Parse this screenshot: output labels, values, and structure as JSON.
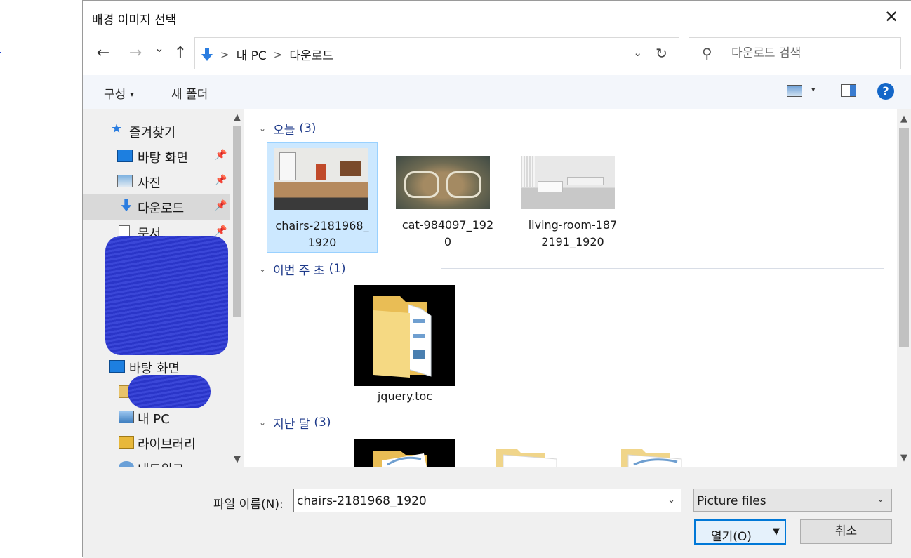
{
  "dialog": {
    "title": "배경 이미지 선택",
    "close_glyph": "✕"
  },
  "nav": {
    "back": "←",
    "forward": "→",
    "recent": "⌄",
    "up": "↑",
    "address": {
      "sep": ">",
      "items": [
        "내 PC",
        "다운로드"
      ],
      "dropdown": "⌄",
      "refresh": "↻"
    },
    "search_placeholder": "다운로드 검색"
  },
  "toolbar": {
    "organize": "구성",
    "caret": "▾",
    "new_folder": "새 폴더",
    "help": "?"
  },
  "sidebar": {
    "quick_access": "즐겨찾기",
    "items": [
      {
        "label": "바탕 화면",
        "pin": "📌"
      },
      {
        "label": "사진",
        "pin": "📌"
      },
      {
        "label": "다운로드",
        "pin": "📌"
      },
      {
        "label": "문서",
        "pin": "📌"
      }
    ],
    "desktop": "바탕 화면",
    "this_pc": "내 PC",
    "libraries": "라이브러리",
    "network": "네트워크",
    "up_arrow": "▲",
    "down_arrow": "▼"
  },
  "content": {
    "groups": [
      {
        "chevron": "⌄",
        "name": "오늘",
        "count": "(3)",
        "files": [
          {
            "line1": "chairs-2181968_",
            "line2": "1920"
          },
          {
            "line1": "cat-984097_192",
            "line2": "0"
          },
          {
            "line1": "living-room-187",
            "line2": "2191_1920"
          }
        ]
      },
      {
        "chevron": "⌄",
        "name": "이번 주 초",
        "count": "(1)",
        "files": [
          {
            "line1": "jquery.toc",
            "line2": ""
          }
        ]
      },
      {
        "chevron": "⌄",
        "name": "지난 달",
        "count": "(3)",
        "files": []
      }
    ]
  },
  "footer": {
    "filename_label": "파일 이름(N):",
    "filename_value": "chairs-2181968_1920",
    "filename_drop": "⌄",
    "filetype_value": "Picture files",
    "filetype_drop": "⌄",
    "open_label": "열기(O)",
    "open_caret": "▼",
    "cancel_label": "취소"
  },
  "colors": {
    "accent": "#0078d7",
    "selection_bg": "#cce8ff",
    "group_header": "#1e3a8a",
    "redaction": "#2a35c8"
  }
}
